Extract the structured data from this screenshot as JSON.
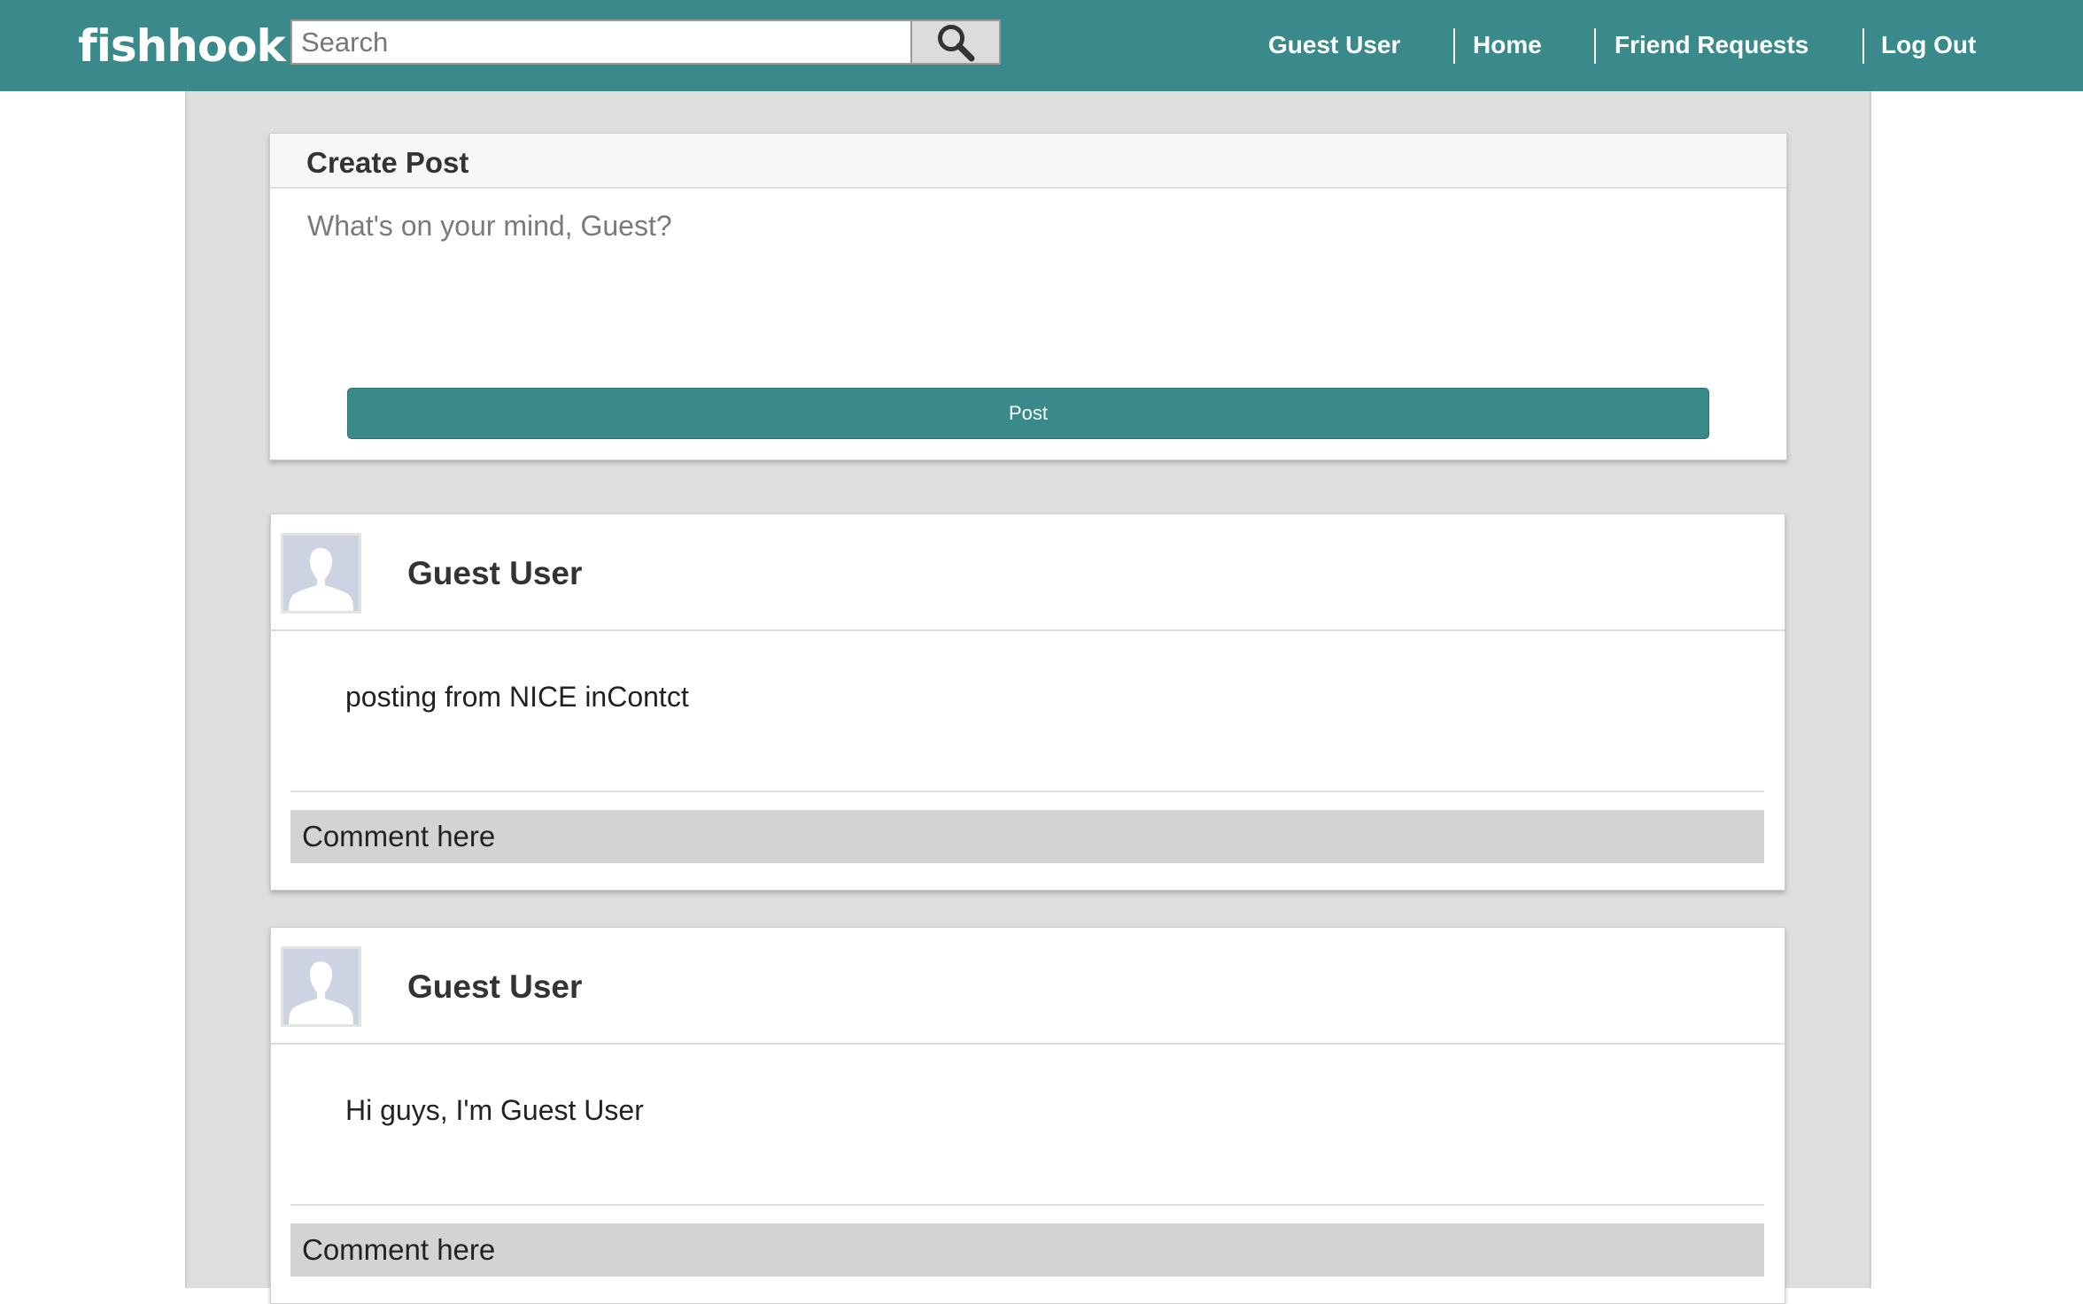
{
  "app": {
    "logo_text": "fishhook",
    "brand_color": "#3b8a8b"
  },
  "search": {
    "placeholder": "Search",
    "button_icon": "search-icon"
  },
  "nav": {
    "items": [
      {
        "label": "Guest User"
      },
      {
        "label": "Home"
      },
      {
        "label": "Friend Requests"
      },
      {
        "label": "Log Out"
      }
    ]
  },
  "create_post": {
    "title": "Create Post",
    "placeholder": "What's on your mind, Guest?",
    "button_label": "Post"
  },
  "posts": [
    {
      "author": "Guest User",
      "avatar_icon": "default-avatar-icon",
      "body": "posting from NICE inContct",
      "comment_placeholder": "Comment here"
    },
    {
      "author": "Guest User",
      "avatar_icon": "default-avatar-icon",
      "body": "Hi guys, I'm Guest User",
      "comment_placeholder": "Comment here"
    }
  ]
}
